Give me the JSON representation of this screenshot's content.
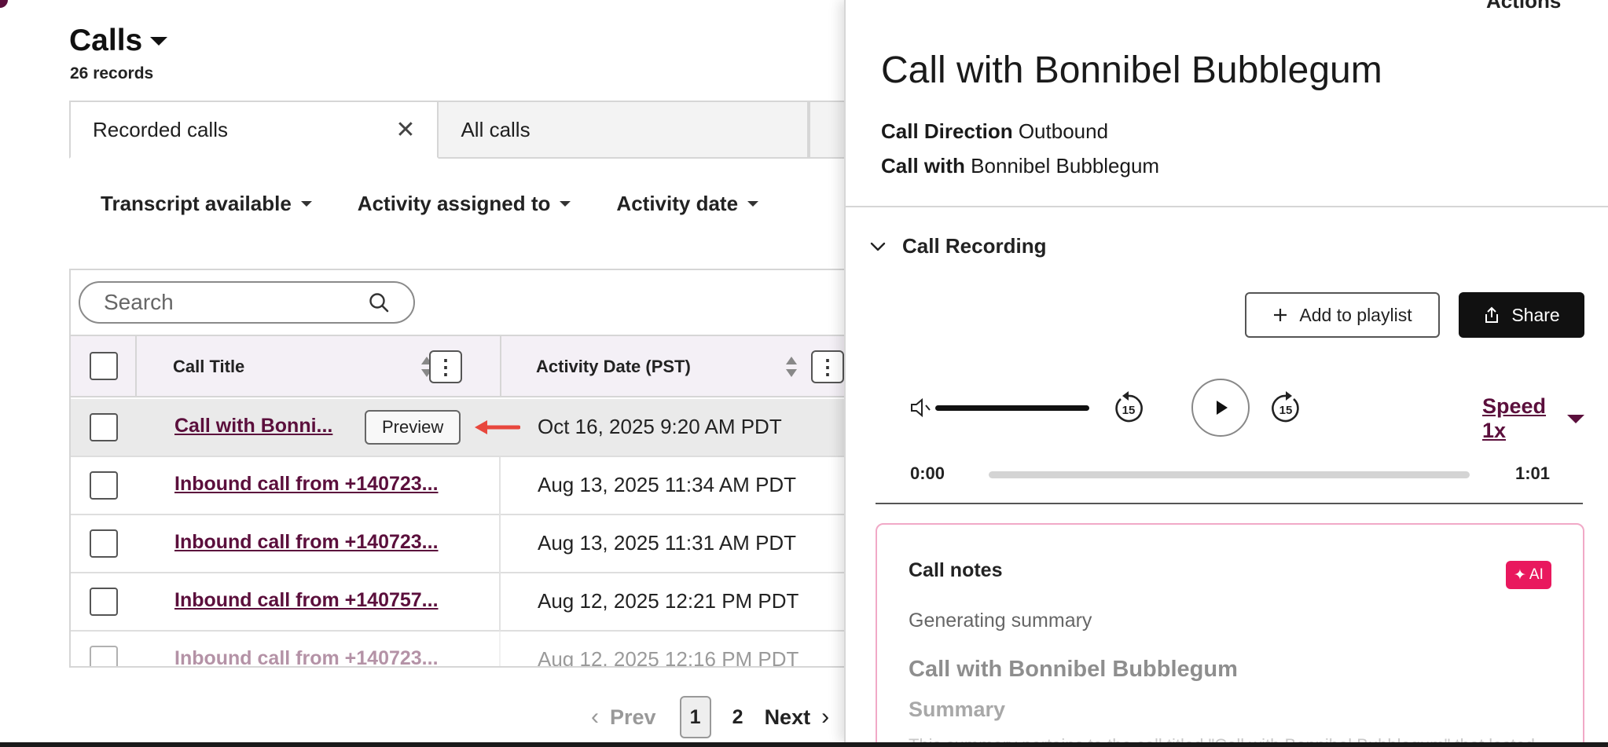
{
  "header": {
    "title": "Calls",
    "record_count": "26 records"
  },
  "view_tabs": {
    "active_label": "Recorded calls",
    "inactive_label": "All calls"
  },
  "filters": [
    "Transcript available",
    "Activity assigned to",
    "Activity date"
  ],
  "search": {
    "placeholder": "Search"
  },
  "table": {
    "columns": {
      "title": "Call Title",
      "date": "Activity Date (PST)"
    },
    "preview_label": "Preview",
    "rows": [
      {
        "title": "Call with Bonni...",
        "date": "Oct 16, 2025 9:20 AM PDT"
      },
      {
        "title": "Inbound call from +140723...",
        "date": "Aug 13, 2025 11:34 AM PDT"
      },
      {
        "title": "Inbound call from +140723...",
        "date": "Aug 13, 2025 11:31 AM PDT"
      },
      {
        "title": "Inbound call from +140757...",
        "date": "Aug 12, 2025 12:21 PM PDT"
      },
      {
        "title": "Inbound call from +140723...",
        "date": "Aug 12, 2025 12:16 PM PDT"
      }
    ]
  },
  "pagination": {
    "prev": "Prev",
    "current": "1",
    "next_page": "2",
    "next": "Next"
  },
  "panel": {
    "actions": "Actions",
    "title": "Call with Bonnibel Bubblegum",
    "direction_label": "Call Direction",
    "direction_value": "Outbound",
    "with_label": "Call with",
    "with_value": "Bonnibel Bubblegum",
    "section_title": "Call Recording",
    "add_playlist_label": "Add to playlist",
    "share_label": "Share",
    "speed_label": "Speed 1x",
    "time_start": "0:00",
    "time_end": "1:01",
    "progress_fraction": 0.0,
    "skip_seconds": "15",
    "notes": {
      "title": "Call notes",
      "ai_label": "AI",
      "status": "Generating summary",
      "heading": "Call with Bonnibel Bubblegum",
      "subheading": "Summary",
      "body": "This summary pertains to the call titled \"Call with Bonnibel Bubblegum\" that lasted..."
    }
  },
  "colors": {
    "brand_link": "#5b0f3c",
    "ai_badge": "#e9185e",
    "share_button": "#111111",
    "notes_border": "#f1a9c7"
  }
}
